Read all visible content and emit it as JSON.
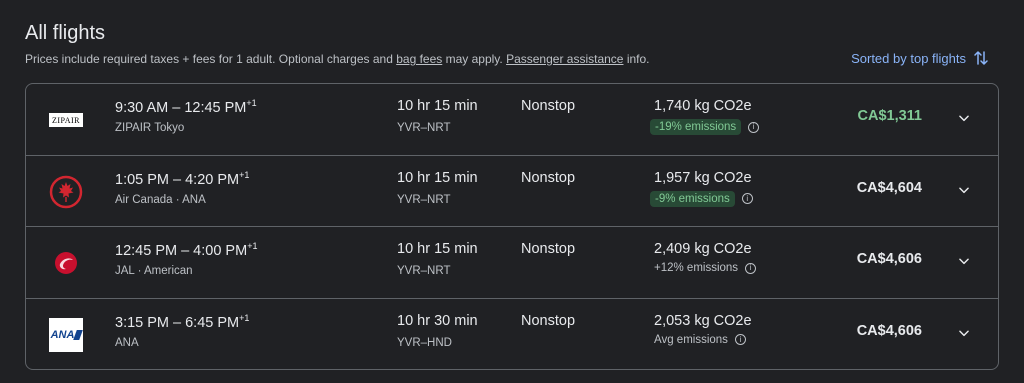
{
  "header": {
    "title": "All flights",
    "subtitle_prefix": "Prices include required taxes + fees for 1 adult. Optional charges and ",
    "bag_fees_link": "bag fees",
    "subtitle_mid": " may apply. ",
    "passenger_link": "Passenger assistance",
    "subtitle_suffix": " info.",
    "sort_label": "Sorted by top flights"
  },
  "colors": {
    "accent": "#8ab4f8",
    "green": "#81c995",
    "badge_bg": "#284a36"
  },
  "flights": [
    {
      "logo": "zipair-logo",
      "logo_text": "ZIPAIR",
      "times": "9:30 AM – 12:45 PM",
      "plus_days": "+1",
      "airline": "ZIPAIR Tokyo",
      "duration": "10 hr 15 min",
      "route": "YVR–NRT",
      "stops": "Nonstop",
      "co2": "1,740 kg CO2e",
      "emissions": "-19% emissions",
      "emissions_badge": true,
      "price": "CA$1,311",
      "price_green": true
    },
    {
      "logo": "air-canada-logo",
      "logo_text": "",
      "times": "1:05 PM – 4:20 PM",
      "plus_days": "+1",
      "airline": "Air Canada · ANA",
      "duration": "10 hr 15 min",
      "route": "YVR–NRT",
      "stops": "Nonstop",
      "co2": "1,957 kg CO2e",
      "emissions": "-9% emissions",
      "emissions_badge": true,
      "price": "CA$4,604",
      "price_green": false
    },
    {
      "logo": "jal-logo",
      "logo_text": "",
      "times": "12:45 PM – 4:00 PM",
      "plus_days": "+1",
      "airline": "JAL · American",
      "duration": "10 hr 15 min",
      "route": "YVR–NRT",
      "stops": "Nonstop",
      "co2": "2,409 kg CO2e",
      "emissions": "+12% emissions",
      "emissions_badge": false,
      "price": "CA$4,606",
      "price_green": false
    },
    {
      "logo": "ana-logo",
      "logo_text": "ANA",
      "times": "3:15 PM – 6:45 PM",
      "plus_days": "+1",
      "airline": "ANA",
      "duration": "10 hr 30 min",
      "route": "YVR–HND",
      "stops": "Nonstop",
      "co2": "2,053 kg CO2e",
      "emissions": "Avg emissions",
      "emissions_badge": false,
      "price": "CA$4,606",
      "price_green": false
    }
  ]
}
